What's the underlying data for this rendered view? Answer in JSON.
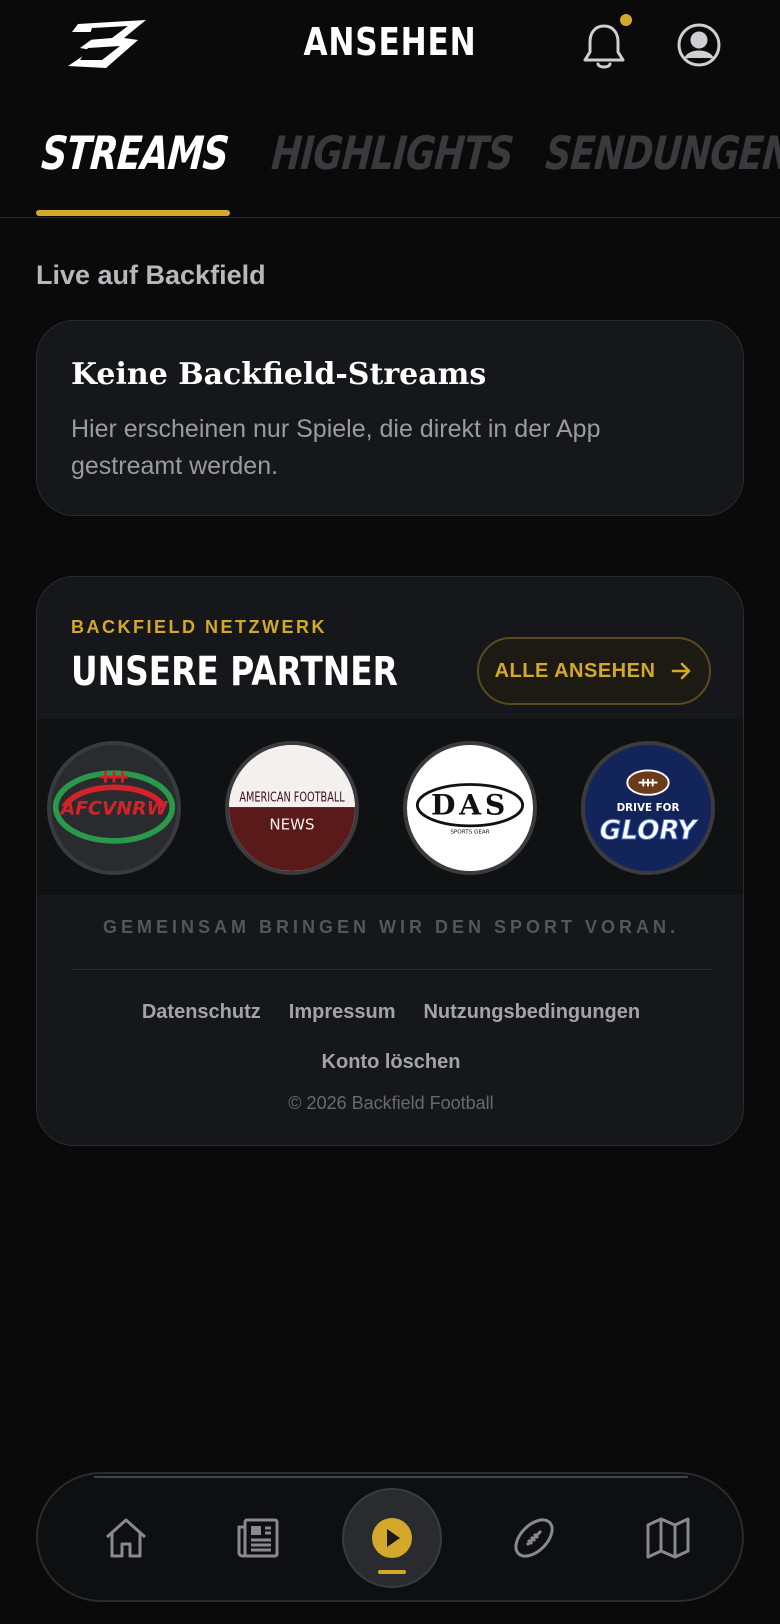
{
  "header": {
    "title": "ANSEHEN",
    "logo_icon": "backfield-logo-icon",
    "notification_icon": "bell-icon",
    "profile_icon": "user-circle-icon",
    "has_unread": true
  },
  "tabs": [
    {
      "label": "STREAMS",
      "active": true
    },
    {
      "label": "HIGHLIGHTS",
      "active": false
    },
    {
      "label": "SENDUNGEN",
      "active": false
    }
  ],
  "live": {
    "section_label": "Live auf Backfield",
    "empty_title": "Keine Backfield-Streams",
    "empty_text": "Hier erscheinen nur Spiele, die direkt in der App gestreamt werden."
  },
  "partners": {
    "kicker": "BACKFIELD NETZWERK",
    "title": "UNSERE PARTNER",
    "see_all_label": "ALLE ANSEHEN",
    "logos": [
      {
        "name": "AFCV NRW",
        "text": "AFCVNRW"
      },
      {
        "name": "American Football News",
        "text_top": "AMERICAN FOOTBALL",
        "text_bottom": "NEWS"
      },
      {
        "name": "DAS Sports Gear",
        "text": "DAS",
        "subtext": "SPORTS GEAR"
      },
      {
        "name": "Drive for Glory",
        "text_top": "DRIVE FOR",
        "text_bottom": "GLORY"
      }
    ],
    "tagline": "GEMEINSAM BRINGEN WIR DEN SPORT VORAN.",
    "footer_links": [
      "Datenschutz",
      "Impressum",
      "Nutzungsbedingungen"
    ],
    "delete_account": "Konto löschen",
    "copyright": "© 2026 Backfield Football"
  },
  "bottom_nav": [
    {
      "icon": "home-icon",
      "active": false
    },
    {
      "icon": "newspaper-icon",
      "active": false
    },
    {
      "icon": "play-icon",
      "active": true
    },
    {
      "icon": "football-icon",
      "active": false
    },
    {
      "icon": "map-icon",
      "active": false
    }
  ],
  "colors": {
    "accent": "#d4a82a",
    "background": "#0a0a0a",
    "card": "#16171a"
  }
}
